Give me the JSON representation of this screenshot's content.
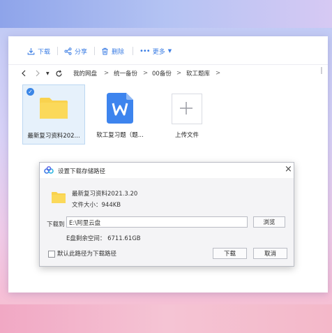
{
  "toolbar": {
    "download_label": "下载",
    "share_label": "分享",
    "delete_label": "删除",
    "more_label": "更多"
  },
  "breadcrumb": [
    "我的网盘",
    "统一备份",
    "00备份",
    "软工题库"
  ],
  "breadcrumb_separator": ">",
  "files": [
    {
      "name": "最新复习资料202...",
      "type": "folder",
      "selected": true
    },
    {
      "name": "软工复习题（题...",
      "type": "word"
    },
    {
      "name": "上传文件",
      "type": "upload"
    }
  ],
  "dialog": {
    "title": "设置下载存储路径",
    "file_name": "最新复习资料2021.3.20",
    "file_size": "文件大小：944KB",
    "download_to_label": "下载到",
    "path_value": "E:\\阿里云盘",
    "browse_label": "浏览",
    "free_space": "E盘剩余空间：  6711.61GB",
    "default_path_label": "默认此路径为下载路径",
    "download_button": "下载",
    "cancel_button": "取消",
    "close_glyph": "×"
  },
  "colors": {
    "accent": "#3b7de4",
    "folder": "#f9d24e",
    "word": "#3d84ee"
  }
}
